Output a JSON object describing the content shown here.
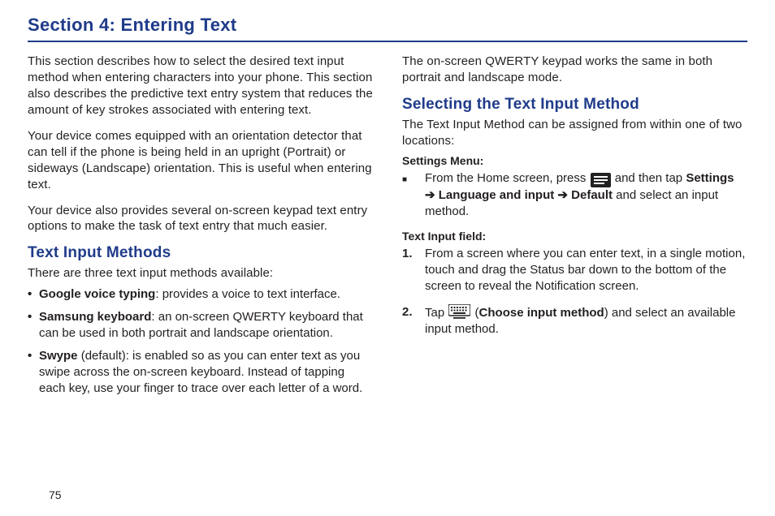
{
  "section_title": "Section 4: Entering Text",
  "left": {
    "p1": "This section describes how to select the desired text input method when entering characters into your phone. This section also describes the predictive text entry system that reduces the amount of key strokes associated with entering text.",
    "p2": "Your device comes equipped with an orientation detector that can tell if the phone is being held in an upright (Portrait) or sideways (Landscape) orientation. This is useful when entering text.",
    "p3": "Your device also provides several on-screen keypad text entry options to make the task of text entry that much easier.",
    "heading": "Text Input Methods",
    "intro": "There are three text input methods available:",
    "bullets": [
      {
        "bold": "Google voice typing",
        "rest": ": provides a voice to text interface."
      },
      {
        "bold": "Samsung keyboard",
        "rest": ": an on-screen QWERTY keyboard that can be used in both portrait and landscape orientation."
      },
      {
        "bold": "Swype",
        "rest": " (default): is enabled so as you can enter text as you swipe across the on-screen keyboard. Instead of tapping each key, use your finger to trace over each letter of a word."
      }
    ]
  },
  "right": {
    "p1": "The on-screen QWERTY keypad works the same in both portrait and landscape mode.",
    "heading": "Selecting the Text Input Method",
    "intro": "The Text Input Method can be assigned from within one of two locations:",
    "settings_menu_label": "Settings Menu:",
    "settings_seq": {
      "pre": "From the Home screen, press ",
      "post1": " and then tap ",
      "bold_settings": "Settings",
      "arrow": " ➔ ",
      "bold_lang": "Language and input",
      "bold_default": "Default",
      "tail": " and select an input method."
    },
    "text_input_field_label": "Text Input field:",
    "steps": [
      {
        "num": "1.",
        "text": "From a screen where you can enter text, in a single motion, touch and drag the Status bar down to the bottom of the screen to reveal the Notification screen."
      },
      {
        "num": "2.",
        "pre": "Tap ",
        "paren_open": " (",
        "bold": "Choose input method",
        "paren_close": ") and select an available input method."
      }
    ]
  },
  "page_number": "75"
}
